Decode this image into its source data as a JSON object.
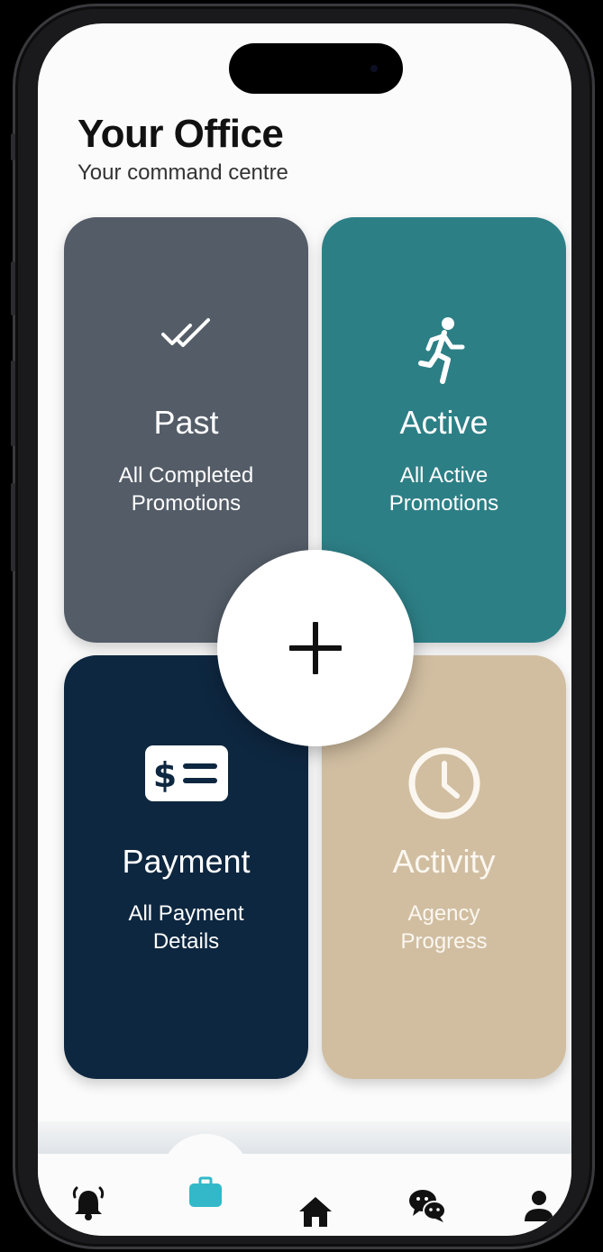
{
  "header": {
    "title": "Your Office",
    "subtitle": "Your command centre"
  },
  "cards": [
    {
      "id": "past",
      "title": "Past",
      "description": "All Completed\nPromotions",
      "icon": "double-check-icon",
      "color": "#535c67"
    },
    {
      "id": "active",
      "title": "Active",
      "description": "All Active\nPromotions",
      "icon": "running-person-icon",
      "color": "#2d7f86"
    },
    {
      "id": "payment",
      "title": "Payment",
      "description": "All Payment\nDetails",
      "icon": "payment-card-icon",
      "color": "#0e2740"
    },
    {
      "id": "activity",
      "title": "Activity",
      "description": "Agency\nProgress",
      "icon": "clock-icon",
      "color": "#d1bea1"
    }
  ],
  "fab": {
    "icon": "plus-icon"
  },
  "tab_bar": {
    "items": [
      {
        "id": "notifications",
        "icon": "bell-icon",
        "active": false
      },
      {
        "id": "office",
        "icon": "briefcase-icon",
        "active": true
      },
      {
        "id": "home",
        "icon": "home-icon",
        "active": false
      },
      {
        "id": "chat",
        "icon": "chat-icon",
        "active": false
      },
      {
        "id": "profile",
        "icon": "person-icon",
        "active": false
      }
    ],
    "active_color": "#33b8c9"
  }
}
